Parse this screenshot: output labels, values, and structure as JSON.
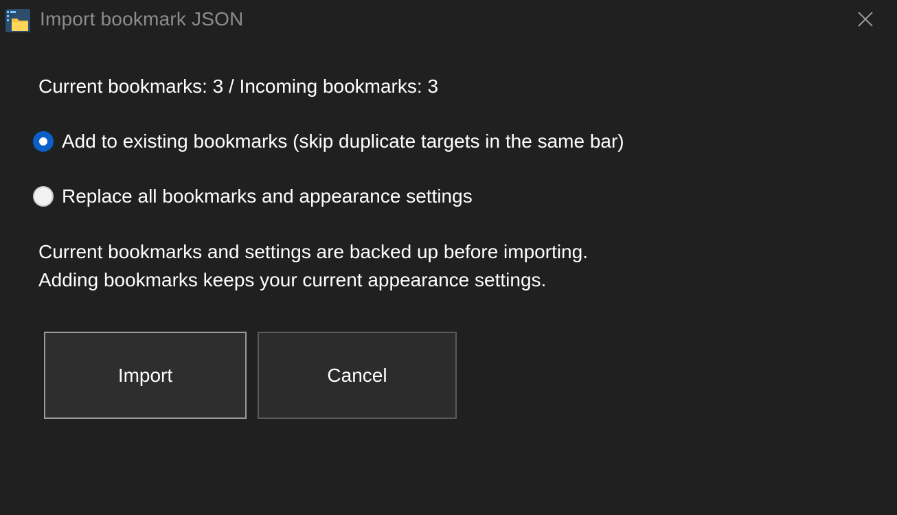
{
  "window": {
    "title": "Import bookmark JSON",
    "icon": "folder-app-icon",
    "close_icon": "close-icon"
  },
  "dialog": {
    "summary": "Current bookmarks: 3 / Incoming bookmarks: 3",
    "options": [
      {
        "label": "Add to existing bookmarks (skip duplicate targets in the same bar)",
        "selected": true
      },
      {
        "label": "Replace all bookmarks and appearance settings",
        "selected": false
      }
    ],
    "notes": [
      "Current bookmarks and settings are backed up before importing.",
      "Adding bookmarks keeps your current appearance settings."
    ],
    "buttons": {
      "import_label": "Import",
      "cancel_label": "Cancel"
    }
  },
  "colors": {
    "background": "#202020",
    "accent": "#0a5fc8",
    "title_text": "#8c8c8c",
    "text": "#ffffff"
  }
}
